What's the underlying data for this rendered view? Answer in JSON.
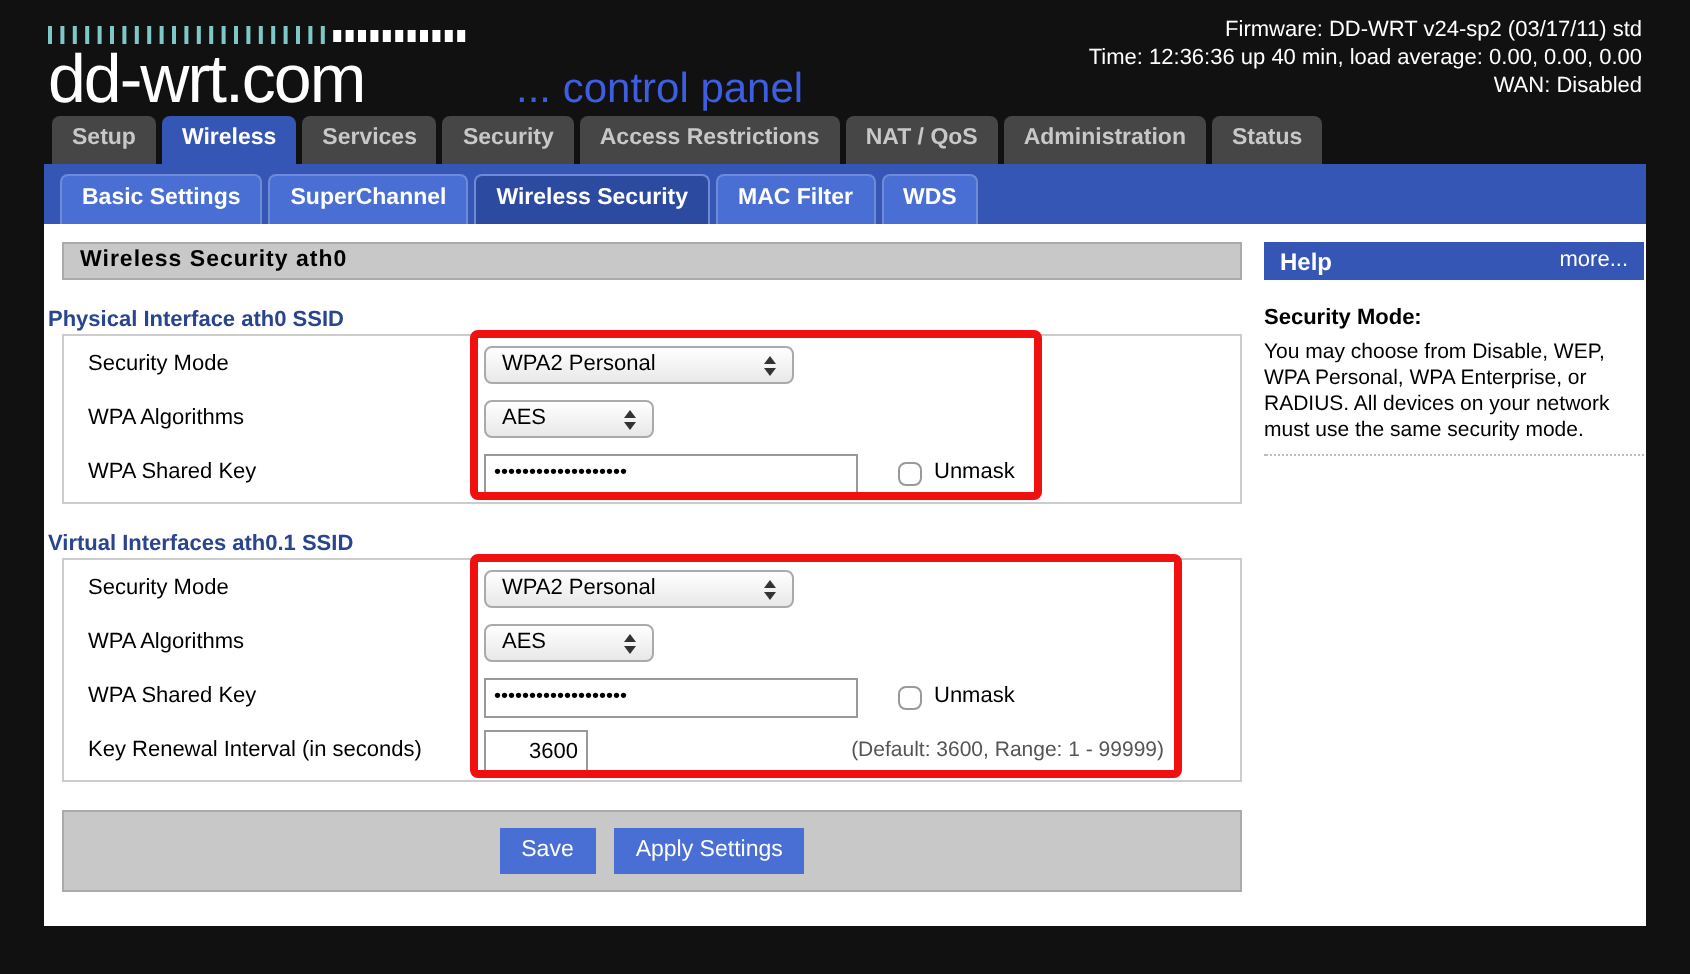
{
  "logo": {
    "brand": "dd-wrt.com",
    "subtitle": "... control panel"
  },
  "status": [
    "Firmware: DD-WRT v24-sp2 (03/17/11) std",
    "Time: 12:36:36 up 40 min, load average: 0.00, 0.00, 0.00",
    "WAN: Disabled"
  ],
  "tabs": [
    {
      "label": "Setup",
      "selected": false
    },
    {
      "label": "Wireless",
      "selected": true
    },
    {
      "label": "Services",
      "selected": false
    },
    {
      "label": "Security",
      "selected": false
    },
    {
      "label": "Access Restrictions",
      "selected": false
    },
    {
      "label": "NAT / QoS",
      "selected": false
    },
    {
      "label": "Administration",
      "selected": false
    },
    {
      "label": "Status",
      "selected": false
    }
  ],
  "subtabs": [
    {
      "label": "Basic Settings",
      "selected": false
    },
    {
      "label": "SuperChannel",
      "selected": false
    },
    {
      "label": "Wireless Security",
      "selected": true
    },
    {
      "label": "MAC Filter",
      "selected": false
    },
    {
      "label": "WDS",
      "selected": false
    }
  ],
  "section_title": "Wireless Security ath0",
  "groups": [
    {
      "title": "Physical Interface ath0 SSID",
      "highlighted": true,
      "fields": [
        {
          "kind": "select",
          "label": "Security Mode",
          "value": "WPA2 Personal",
          "wide": true
        },
        {
          "kind": "select",
          "label": "WPA Algorithms",
          "value": "AES",
          "wide": false
        },
        {
          "kind": "key",
          "label": "WPA Shared Key",
          "value": "•••••••••••••••••••",
          "checkbox": {
            "label": "Unmask",
            "checked": false
          }
        }
      ]
    },
    {
      "title": "Virtual Interfaces ath0.1 SSID",
      "highlighted": true,
      "fields": [
        {
          "kind": "select",
          "label": "Security Mode",
          "value": "WPA2 Personal",
          "wide": true
        },
        {
          "kind": "select",
          "label": "WPA Algorithms",
          "value": "AES",
          "wide": false
        },
        {
          "kind": "key",
          "label": "WPA Shared Key",
          "value": "•••••••••••••••••••",
          "checkbox": {
            "label": "Unmask",
            "checked": false
          }
        },
        {
          "kind": "number",
          "label": "Key Renewal Interval (in seconds)",
          "value": "3600",
          "hint": "(Default: 3600, Range: 1 - 99999)"
        }
      ]
    }
  ],
  "buttons": [
    "Save",
    "Apply Settings"
  ],
  "help": {
    "title": "Help",
    "more": "more...",
    "heading": "Security Mode:",
    "text": "You may choose from Disable, WEP, WPA Personal, WPA Enterprise, or RADIUS. All devices on your network must use the same security mode."
  }
}
